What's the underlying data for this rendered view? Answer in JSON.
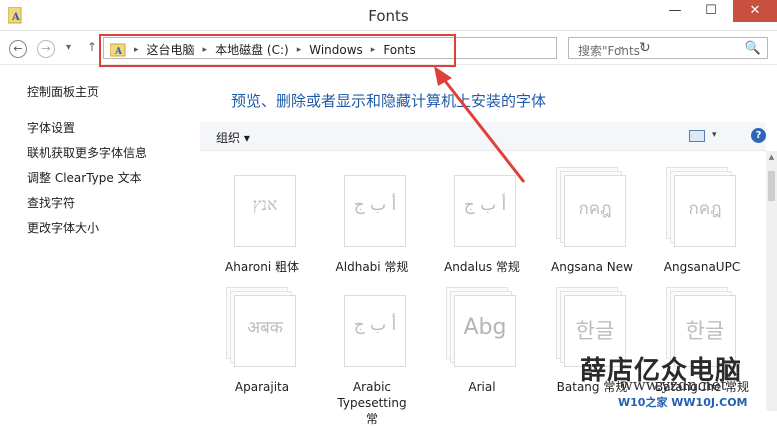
{
  "window": {
    "title": "Fonts",
    "minimize_label": "—",
    "maximize_label": "☐",
    "close_label": "✕"
  },
  "nav": {
    "back_icon": "back-arrow-icon",
    "forward_icon": "forward-arrow-icon",
    "up_icon": "up-arrow-icon",
    "back_label": "←",
    "forward_label": "→",
    "recent_label": "▾",
    "up_label": "↑"
  },
  "address": {
    "crumbs": [
      "这台电脑",
      "本地磁盘 (C:)",
      "Windows",
      "Fonts"
    ],
    "sep": "▸",
    "dropdown": "⌄",
    "refresh": "↻"
  },
  "search": {
    "placeholder": "搜索\"Fonts\"",
    "icon_label": "🔍"
  },
  "sidebar": {
    "home": "控制面板主页",
    "items": [
      "字体设置",
      "联机获取更多字体信息",
      "调整 ClearType 文本",
      "查找字符",
      "更改字体大小"
    ]
  },
  "main": {
    "heading": "预览、删除或者显示和隐藏计算机上安装的字体",
    "organize": "组织 ▾",
    "view_dd": "▾",
    "help": "?"
  },
  "fonts": [
    {
      "name": "Aharoni 粗体",
      "sample": "אנץ"
    },
    {
      "name": "Aldhabi 常规",
      "sample": "أ ب ج"
    },
    {
      "name": "Andalus 常规",
      "sample": "أ ب ج"
    },
    {
      "name": "Angsana New",
      "sample": "กคฎ"
    },
    {
      "name": "AngsanaUPC",
      "sample": "กคฎ"
    },
    {
      "name": "Aparajita",
      "sample": "अबक"
    },
    {
      "name": "Arabic Typesetting 常",
      "sample": "أ ب ج"
    },
    {
      "name": "Arial",
      "sample": "Abg"
    },
    {
      "name": "Batang 常规",
      "sample": "한글"
    },
    {
      "name": "BatangChe 常规",
      "sample": "한글"
    }
  ],
  "watermark": {
    "main": "薛店亿众电脑",
    "sub": "www.yzdn.net",
    "tiny": "W10之家 WW10J.COM"
  },
  "colors": {
    "highlight": "#e0403a",
    "heading": "#1f5ba7",
    "close": "#c7503e"
  }
}
